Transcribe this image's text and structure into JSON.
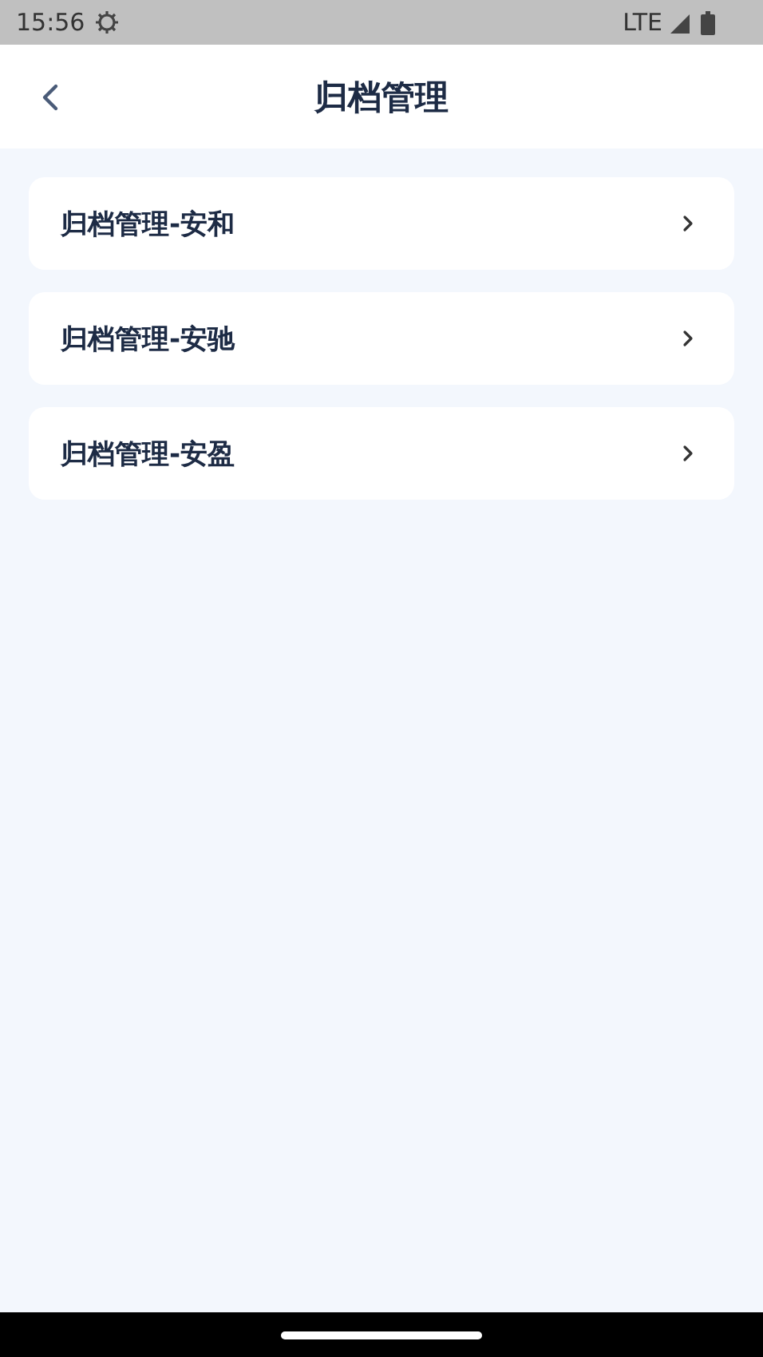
{
  "status_bar": {
    "time": "15:56",
    "network": "LTE"
  },
  "header": {
    "title": "归档管理"
  },
  "items": [
    {
      "label": "归档管理-安和"
    },
    {
      "label": "归档管理-安驰"
    },
    {
      "label": "归档管理-安盈"
    }
  ]
}
